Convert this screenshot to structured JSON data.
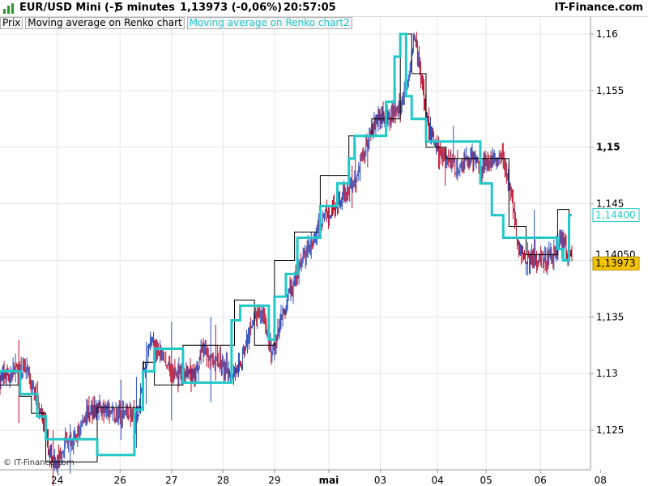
{
  "header": {
    "instrument": "EUR/USD Mini (-)",
    "timeframe": "5 minutes",
    "quote": "1,13973 (-0,06%)",
    "time": "20:57:05",
    "brand": "IT-Finance.com"
  },
  "legend": {
    "items": [
      {
        "label": "Prix"
      },
      {
        "label": "Moving average on Renko chart"
      },
      {
        "label": "Moving average on Renko chart2"
      }
    ]
  },
  "watermark": "© IT-Finance.com",
  "colors": {
    "up": "#2a4fc0",
    "down": "#c0102a",
    "renko_black": "#000000",
    "renko_cyan": "#22c8c8",
    "highlight_price": "#f5c400",
    "grid": "#e6e6e6"
  },
  "chart_data": {
    "type": "line",
    "title": "EUR/USD Mini (-)",
    "ylim": [
      1.1215,
      1.1615
    ],
    "y_ticks": [
      {
        "value": 1.16,
        "label": "1,16",
        "bold": false
      },
      {
        "value": 1.155,
        "label": "1,155",
        "bold": false
      },
      {
        "value": 1.15,
        "label": "1,15",
        "bold": true
      },
      {
        "value": 1.145,
        "label": "1,145",
        "bold": false
      },
      {
        "value": 1.14,
        "label": "",
        "bold": false
      },
      {
        "value": 1.135,
        "label": "1,135",
        "bold": false
      },
      {
        "value": 1.13,
        "label": "1,13",
        "bold": false
      },
      {
        "value": 1.125,
        "label": "1,125",
        "bold": false
      }
    ],
    "x_ticks": [
      {
        "pos": 0.1,
        "label": "24",
        "bold": false
      },
      {
        "pos": 0.21,
        "label": "26",
        "bold": false
      },
      {
        "pos": 0.3,
        "label": "27",
        "bold": false
      },
      {
        "pos": 0.39,
        "label": "28",
        "bold": false
      },
      {
        "pos": 0.48,
        "label": "29",
        "bold": false
      },
      {
        "pos": 0.575,
        "label": "mai",
        "bold": true
      },
      {
        "pos": 0.665,
        "label": "03",
        "bold": false
      },
      {
        "pos": 0.765,
        "label": "04",
        "bold": false
      },
      {
        "pos": 0.85,
        "label": "05",
        "bold": false
      },
      {
        "pos": 0.945,
        "label": "06",
        "bold": false
      },
      {
        "pos": 1.05,
        "label": "08",
        "bold": false
      }
    ],
    "price_labels": [
      {
        "value": 1.144,
        "label": "1,14400",
        "style": "cyan"
      },
      {
        "value": 1.1405,
        "label": "1,14050",
        "style": "plain"
      },
      {
        "value": 1.13973,
        "label": "1,13973",
        "style": "highlight"
      }
    ],
    "price_path": [
      [
        0.0,
        1.1296
      ],
      [
        0.02,
        1.13
      ],
      [
        0.04,
        1.1306
      ],
      [
        0.055,
        1.1292
      ],
      [
        0.07,
        1.127
      ],
      [
        0.085,
        1.123
      ],
      [
        0.1,
        1.1222
      ],
      [
        0.115,
        1.124
      ],
      [
        0.13,
        1.124
      ],
      [
        0.15,
        1.1265
      ],
      [
        0.17,
        1.127
      ],
      [
        0.185,
        1.1268
      ],
      [
        0.2,
        1.1262
      ],
      [
        0.22,
        1.1268
      ],
      [
        0.24,
        1.1258
      ],
      [
        0.25,
        1.1295
      ],
      [
        0.265,
        1.133
      ],
      [
        0.28,
        1.1315
      ],
      [
        0.3,
        1.13
      ],
      [
        0.32,
        1.13
      ],
      [
        0.34,
        1.1295
      ],
      [
        0.355,
        1.1325
      ],
      [
        0.37,
        1.131
      ],
      [
        0.385,
        1.131
      ],
      [
        0.4,
        1.13
      ],
      [
        0.42,
        1.1305
      ],
      [
        0.44,
        1.1345
      ],
      [
        0.46,
        1.1355
      ],
      [
        0.475,
        1.1315
      ],
      [
        0.49,
        1.1345
      ],
      [
        0.505,
        1.137
      ],
      [
        0.525,
        1.1395
      ],
      [
        0.54,
        1.141
      ],
      [
        0.56,
        1.1435
      ],
      [
        0.58,
        1.1445
      ],
      [
        0.6,
        1.1455
      ],
      [
        0.62,
        1.147
      ],
      [
        0.64,
        1.15
      ],
      [
        0.66,
        1.1525
      ],
      [
        0.68,
        1.1525
      ],
      [
        0.7,
        1.1535
      ],
      [
        0.715,
        1.1565
      ],
      [
        0.725,
        1.16
      ],
      [
        0.735,
        1.1565
      ],
      [
        0.745,
        1.153
      ],
      [
        0.76,
        1.15
      ],
      [
        0.78,
        1.149
      ],
      [
        0.8,
        1.148
      ],
      [
        0.82,
        1.149
      ],
      [
        0.84,
        1.1485
      ],
      [
        0.86,
        1.149
      ],
      [
        0.88,
        1.149
      ],
      [
        0.895,
        1.146
      ],
      [
        0.905,
        1.1415
      ],
      [
        0.915,
        1.1405
      ],
      [
        0.93,
        1.14
      ],
      [
        0.95,
        1.14
      ],
      [
        0.97,
        1.1405
      ],
      [
        0.98,
        1.142
      ],
      [
        0.99,
        1.141
      ],
      [
        1.0,
        1.1397
      ]
    ],
    "renko_black": [
      [
        0.0,
        1.129
      ],
      [
        0.035,
        1.129
      ],
      [
        0.035,
        1.128
      ],
      [
        0.055,
        1.128
      ],
      [
        0.055,
        1.1265
      ],
      [
        0.08,
        1.1265
      ],
      [
        0.08,
        1.1222
      ],
      [
        0.17,
        1.1222
      ],
      [
        0.17,
        1.127
      ],
      [
        0.25,
        1.127
      ],
      [
        0.25,
        1.131
      ],
      [
        0.27,
        1.131
      ],
      [
        0.27,
        1.129
      ],
      [
        0.32,
        1.129
      ],
      [
        0.32,
        1.1325
      ],
      [
        0.41,
        1.1325
      ],
      [
        0.41,
        1.1365
      ],
      [
        0.445,
        1.1365
      ],
      [
        0.445,
        1.1325
      ],
      [
        0.48,
        1.1325
      ],
      [
        0.48,
        1.14
      ],
      [
        0.515,
        1.14
      ],
      [
        0.515,
        1.1425
      ],
      [
        0.56,
        1.1425
      ],
      [
        0.56,
        1.1475
      ],
      [
        0.61,
        1.1475
      ],
      [
        0.61,
        1.151
      ],
      [
        0.65,
        1.151
      ],
      [
        0.65,
        1.1525
      ],
      [
        0.7,
        1.1525
      ],
      [
        0.7,
        1.16
      ],
      [
        0.72,
        1.16
      ],
      [
        0.72,
        1.1565
      ],
      [
        0.745,
        1.1565
      ],
      [
        0.745,
        1.15
      ],
      [
        0.78,
        1.15
      ],
      [
        0.78,
        1.149
      ],
      [
        0.89,
        1.149
      ],
      [
        0.89,
        1.143
      ],
      [
        0.92,
        1.143
      ],
      [
        0.92,
        1.1405
      ],
      [
        0.975,
        1.1405
      ],
      [
        0.975,
        1.1445
      ],
      [
        0.995,
        1.1445
      ],
      [
        0.995,
        1.1405
      ],
      [
        1.0,
        1.1405
      ]
    ],
    "renko_cyan": [
      [
        0.0,
        1.1302
      ],
      [
        0.035,
        1.1302
      ],
      [
        0.035,
        1.1282
      ],
      [
        0.065,
        1.1282
      ],
      [
        0.065,
        1.1262
      ],
      [
        0.08,
        1.1262
      ],
      [
        0.08,
        1.1242
      ],
      [
        0.17,
        1.1242
      ],
      [
        0.17,
        1.1228
      ],
      [
        0.235,
        1.1228
      ],
      [
        0.235,
        1.1268
      ],
      [
        0.25,
        1.1268
      ],
      [
        0.25,
        1.1302
      ],
      [
        0.27,
        1.1302
      ],
      [
        0.27,
        1.1322
      ],
      [
        0.32,
        1.1322
      ],
      [
        0.32,
        1.1292
      ],
      [
        0.405,
        1.1292
      ],
      [
        0.405,
        1.1347
      ],
      [
        0.42,
        1.1347
      ],
      [
        0.42,
        1.136
      ],
      [
        0.47,
        1.136
      ],
      [
        0.47,
        1.133
      ],
      [
        0.48,
        1.133
      ],
      [
        0.48,
        1.1368
      ],
      [
        0.5,
        1.1368
      ],
      [
        0.5,
        1.1388
      ],
      [
        0.52,
        1.1388
      ],
      [
        0.52,
        1.142
      ],
      [
        0.56,
        1.142
      ],
      [
        0.56,
        1.1448
      ],
      [
        0.59,
        1.1448
      ],
      [
        0.59,
        1.1468
      ],
      [
        0.61,
        1.1468
      ],
      [
        0.61,
        1.149
      ],
      [
        0.62,
        1.149
      ],
      [
        0.62,
        1.151
      ],
      [
        0.675,
        1.151
      ],
      [
        0.675,
        1.154
      ],
      [
        0.69,
        1.154
      ],
      [
        0.69,
        1.158
      ],
      [
        0.7,
        1.158
      ],
      [
        0.7,
        1.16
      ],
      [
        0.71,
        1.16
      ],
      [
        0.71,
        1.1545
      ],
      [
        0.72,
        1.1545
      ],
      [
        0.72,
        1.1525
      ],
      [
        0.745,
        1.1525
      ],
      [
        0.745,
        1.1505
      ],
      [
        0.84,
        1.1505
      ],
      [
        0.84,
        1.1468
      ],
      [
        0.86,
        1.1468
      ],
      [
        0.86,
        1.144
      ],
      [
        0.88,
        1.144
      ],
      [
        0.88,
        1.142
      ],
      [
        0.975,
        1.142
      ],
      [
        0.975,
        1.141
      ],
      [
        0.985,
        1.141
      ],
      [
        0.985,
        1.14
      ],
      [
        0.995,
        1.14
      ],
      [
        0.995,
        1.144
      ],
      [
        1.0,
        1.144
      ]
    ]
  }
}
